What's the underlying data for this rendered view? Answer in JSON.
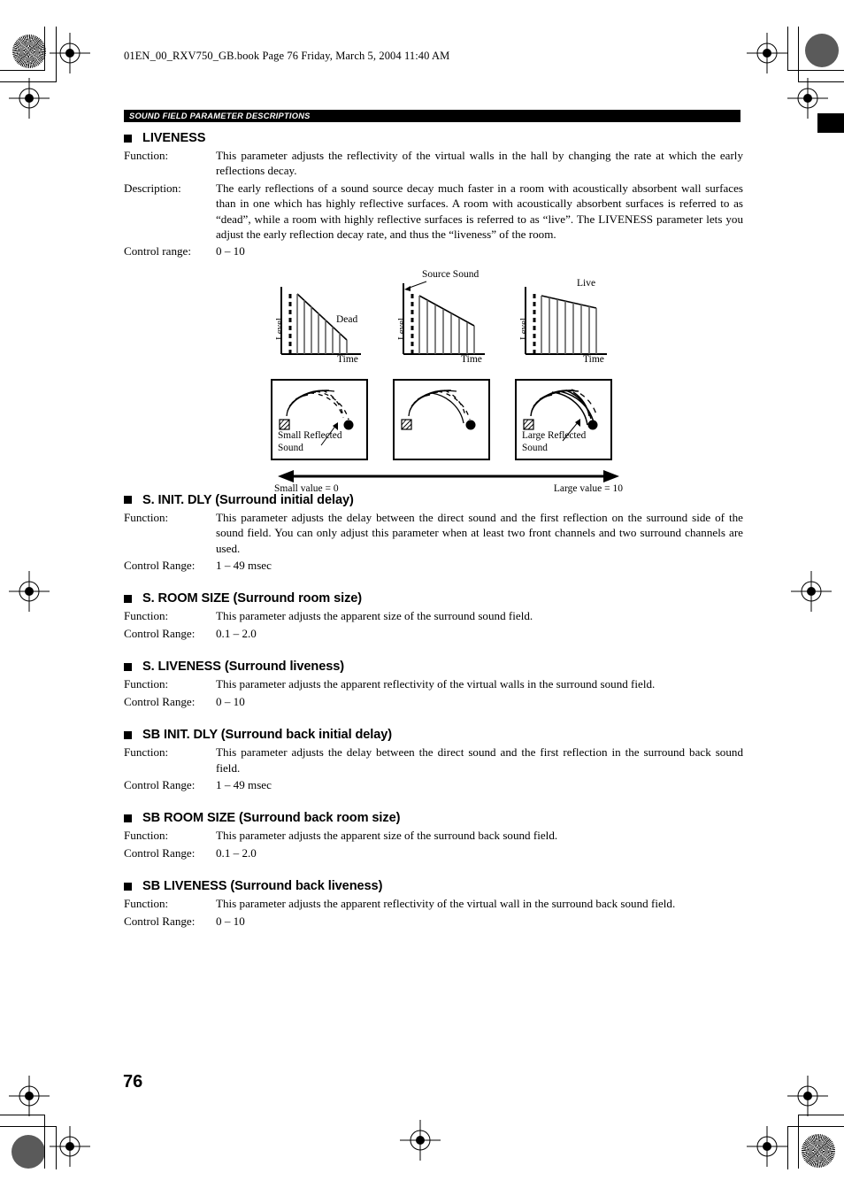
{
  "header": {
    "file_info": "01EN_00_RXV750_GB.book  Page 76  Friday, March 5, 2004  11:40 AM"
  },
  "section_banner": "SOUND FIELD PARAMETER DESCRIPTIONS",
  "page_number": "76",
  "labels": {
    "function": "Function:",
    "description": "Description:",
    "control_range_lower": "Control range:",
    "control_range_upper": "Control Range:"
  },
  "sections": [
    {
      "heading": "LIVENESS",
      "function": "This parameter adjusts the reflectivity of the virtual walls in the hall by changing the rate at which the early reflections decay.",
      "description": "The early reflections of a sound source decay much faster in a room with acoustically absorbent wall surfaces than in one which has highly reflective surfaces. A room with acoustically absorbent surfaces is referred to as “dead”, while a room with highly reflective surfaces is referred to as “live”. The LIVENESS parameter lets you adjust the early reflection decay rate, and thus the “liveness” of the room.",
      "range_label": "Control range:",
      "range": "0 – 10"
    },
    {
      "heading": "S. INIT. DLY (Surround initial delay)",
      "function": "This parameter adjusts the delay between the direct sound and the first reflection on the surround side of the sound field. You can only adjust this parameter when at least two front channels and two surround channels are used.",
      "range_label": "Control Range:",
      "range": "1 – 49 msec"
    },
    {
      "heading": "S. ROOM SIZE (Surround room size)",
      "function": "This parameter adjusts the apparent size of the surround sound field.",
      "range_label": "Control Range:",
      "range": "0.1 – 2.0"
    },
    {
      "heading": "S. LIVENESS (Surround liveness)",
      "function": "This parameter adjusts the apparent reflectivity of the virtual walls in the surround sound field.",
      "range_label": "Control Range:",
      "range": "0 – 10"
    },
    {
      "heading": "SB INIT. DLY (Surround back initial delay)",
      "function": "This parameter adjusts the delay between the direct sound and the first reflection in the surround back sound field.",
      "range_label": "Control Range:",
      "range": "1 – 49 msec"
    },
    {
      "heading": "SB ROOM SIZE (Surround back room size)",
      "function": "This parameter adjusts the apparent size of the surround back sound field.",
      "range_label": "Control Range:",
      "range": "0.1 – 2.0"
    },
    {
      "heading": "SB LIVENESS (Surround back liveness)",
      "function": "This parameter adjusts the apparent reflectivity of the virtual wall in the surround back sound field.",
      "range_label": "Control Range:",
      "range": "0 – 10"
    }
  ],
  "figure": {
    "graphs": [
      {
        "axis_y": "Level",
        "axis_x": "Time",
        "annotation": "Dead",
        "decay": "fast"
      },
      {
        "axis_y": "Level",
        "axis_x": "Time",
        "annotation": "Source Sound",
        "decay": "medium"
      },
      {
        "axis_y": "Level",
        "axis_x": "Time",
        "annotation": "Live",
        "decay": "slow"
      }
    ],
    "panels": [
      {
        "caption_line1": "Small Reflected",
        "caption_line2": "Sound"
      },
      {
        "caption_line1": "",
        "caption_line2": ""
      },
      {
        "caption_line1": "Large Reflected",
        "caption_line2": "Sound"
      }
    ],
    "scale_left": "Small value = 0",
    "scale_right": "Large value = 10"
  }
}
